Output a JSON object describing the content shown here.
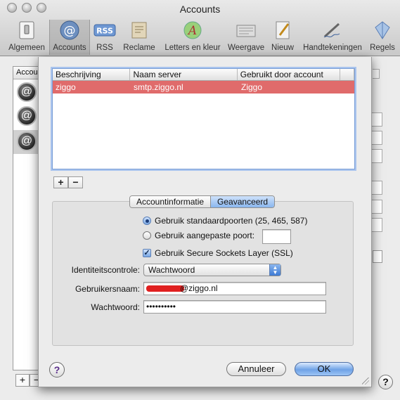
{
  "window": {
    "title": "Accounts"
  },
  "toolbar": {
    "items": [
      {
        "label": "Algemeen",
        "icon": "general-switch-icon"
      },
      {
        "label": "Accounts",
        "icon": "at-sign-icon",
        "selected": true
      },
      {
        "label": "RSS",
        "icon": "rss-icon"
      },
      {
        "label": "Reclame",
        "icon": "junk-mail-icon"
      },
      {
        "label": "Letters en kleur",
        "icon": "fonts-colors-icon"
      },
      {
        "label": "Weergave",
        "icon": "viewing-icon"
      },
      {
        "label": "Nieuw",
        "icon": "composing-icon"
      },
      {
        "label": "Handtekeningen",
        "icon": "signatures-icon"
      },
      {
        "label": "Regels",
        "icon": "rules-icon"
      }
    ]
  },
  "background": {
    "list_header": "Accou",
    "add_label": "+",
    "remove_label": "−",
    "help_label": "?"
  },
  "smtp_sheet": {
    "columns": [
      "Beschrijving",
      "Naam server",
      "Gebruikt door account"
    ],
    "rows": [
      {
        "description": "ziggo",
        "server": "smtp.ziggo.nl",
        "account": "Ziggo"
      }
    ],
    "add_label": "+",
    "remove_label": "−",
    "tabs": [
      "Accountinformatie",
      "Geavanceerd"
    ],
    "ports": {
      "default_label": "Gebruik standaardpoorten (25, 465, 587)",
      "custom_label": "Gebruik aangepaste poort:",
      "custom_value": ""
    },
    "ssl_label": "Gebruik Secure Sockets Layer (SSL)",
    "auth": {
      "label": "Identiteitscontrole:",
      "value": "Wachtwoord"
    },
    "username": {
      "label": "Gebruikersnaam:",
      "value": "@ziggo.nl"
    },
    "password": {
      "label": "Wachtwoord:",
      "value": "••••••••••"
    },
    "help_label": "?",
    "cancel_label": "Annuleer",
    "ok_label": "OK"
  },
  "colors": {
    "selected_row": "#e06b6b",
    "accent": "#6fa2e6"
  }
}
